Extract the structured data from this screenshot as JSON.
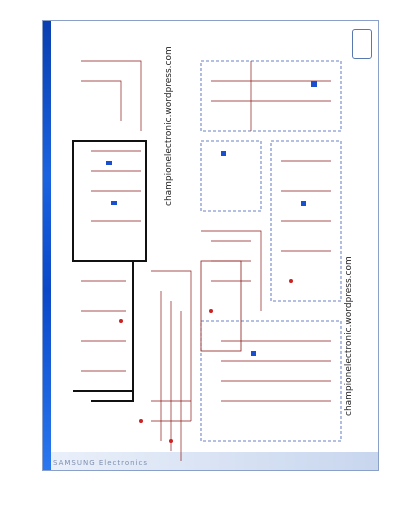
{
  "watermarks": [
    "championelectronic.wordpress.com",
    "championelectronic.wordpress.com"
  ],
  "footer": {
    "brand": "SAMSUNG Electronics"
  },
  "logo": {
    "name": "samsung-logo"
  },
  "colors": {
    "wire": "#8b1a1a",
    "border": "#1a1a1a",
    "dashed": "#3a5ab0",
    "accent": "#1a4fd0"
  }
}
